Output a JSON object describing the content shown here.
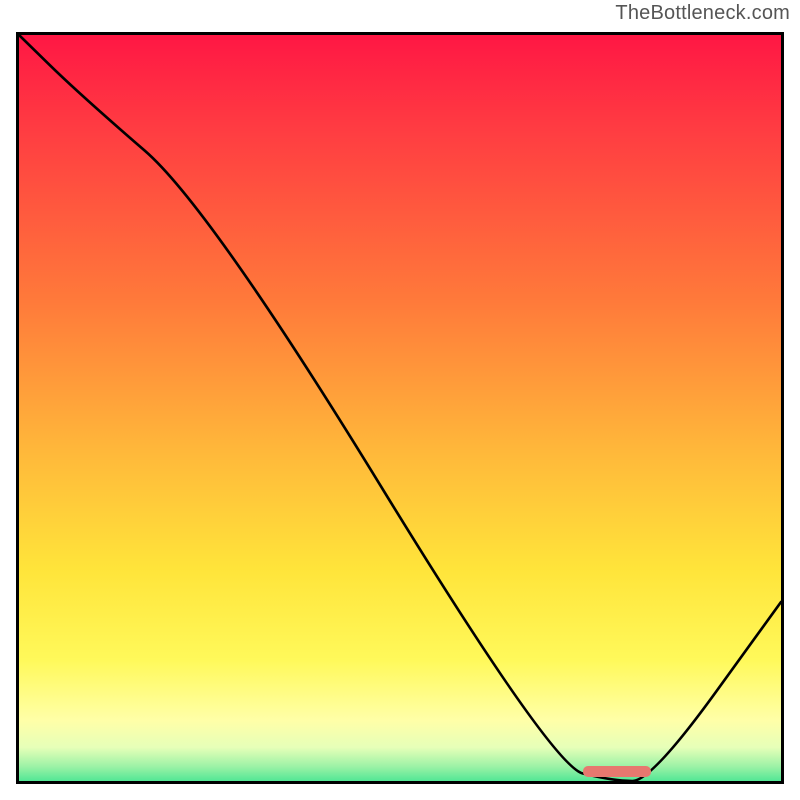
{
  "watermark": "TheBottleneck.com",
  "chart_data": {
    "type": "line",
    "title": "",
    "xlabel": "",
    "ylabel": "",
    "xlim": [
      0,
      100
    ],
    "ylim": [
      0,
      100
    ],
    "gradient_stops": [
      {
        "offset": 0,
        "color": "#ff1744"
      },
      {
        "offset": 0.12,
        "color": "#ff3b42"
      },
      {
        "offset": 0.35,
        "color": "#ff7a3a"
      },
      {
        "offset": 0.55,
        "color": "#ffb93a"
      },
      {
        "offset": 0.7,
        "color": "#ffe43a"
      },
      {
        "offset": 0.82,
        "color": "#fff95a"
      },
      {
        "offset": 0.9,
        "color": "#ffffa8"
      },
      {
        "offset": 0.935,
        "color": "#e6ffb8"
      },
      {
        "offset": 0.96,
        "color": "#9cf2a6"
      },
      {
        "offset": 0.99,
        "color": "#28e08c"
      },
      {
        "offset": 1.0,
        "color": "#17d880"
      }
    ],
    "series": [
      {
        "name": "curve",
        "x": [
          0,
          8,
          25,
          70,
          78,
          83,
          100
        ],
        "y": [
          100,
          92,
          77,
          2,
          0,
          0,
          24
        ]
      }
    ],
    "marker": {
      "x_start": 74,
      "x_end": 83,
      "y": 1.3,
      "color": "#e7786f"
    }
  }
}
